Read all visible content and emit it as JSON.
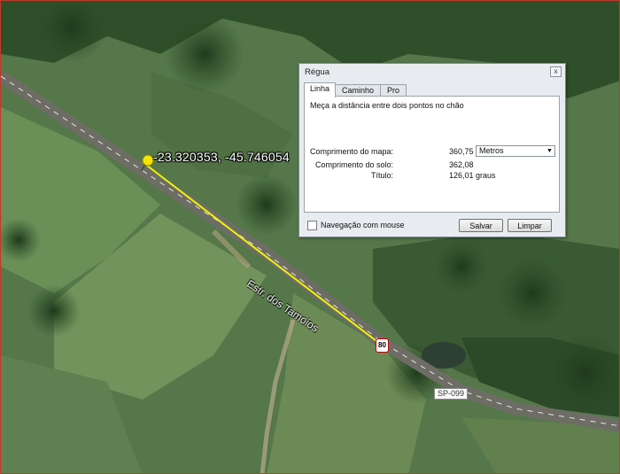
{
  "map": {
    "coordinates_label": "-23.320353, -45.746054",
    "road_label": "Estr. dos Tamoios",
    "route_number": "80",
    "route_sp_label": "SP-099",
    "pin_icon": "yellow-pushpin-icon"
  },
  "dialog": {
    "title": "Régua",
    "close_symbol": "x",
    "tabs": [
      {
        "label": "Linha",
        "active": true
      },
      {
        "label": "Caminho",
        "active": false
      },
      {
        "label": "Pro",
        "active": false
      }
    ],
    "description": "Meça a distância entre dois pontos no chão",
    "map_length": {
      "label": "Comprimento do mapa:",
      "value": "360,75"
    },
    "unit_select": {
      "value": "Metros"
    },
    "ground_length": {
      "label": "Comprimento do solo:",
      "value": "362,08"
    },
    "heading": {
      "label": "Título:",
      "value": "126,01 graus"
    },
    "mouse_nav": {
      "label": "Navegação com mouse",
      "checked": false
    },
    "save_label": "Salvar",
    "clear_label": "Limpar"
  }
}
